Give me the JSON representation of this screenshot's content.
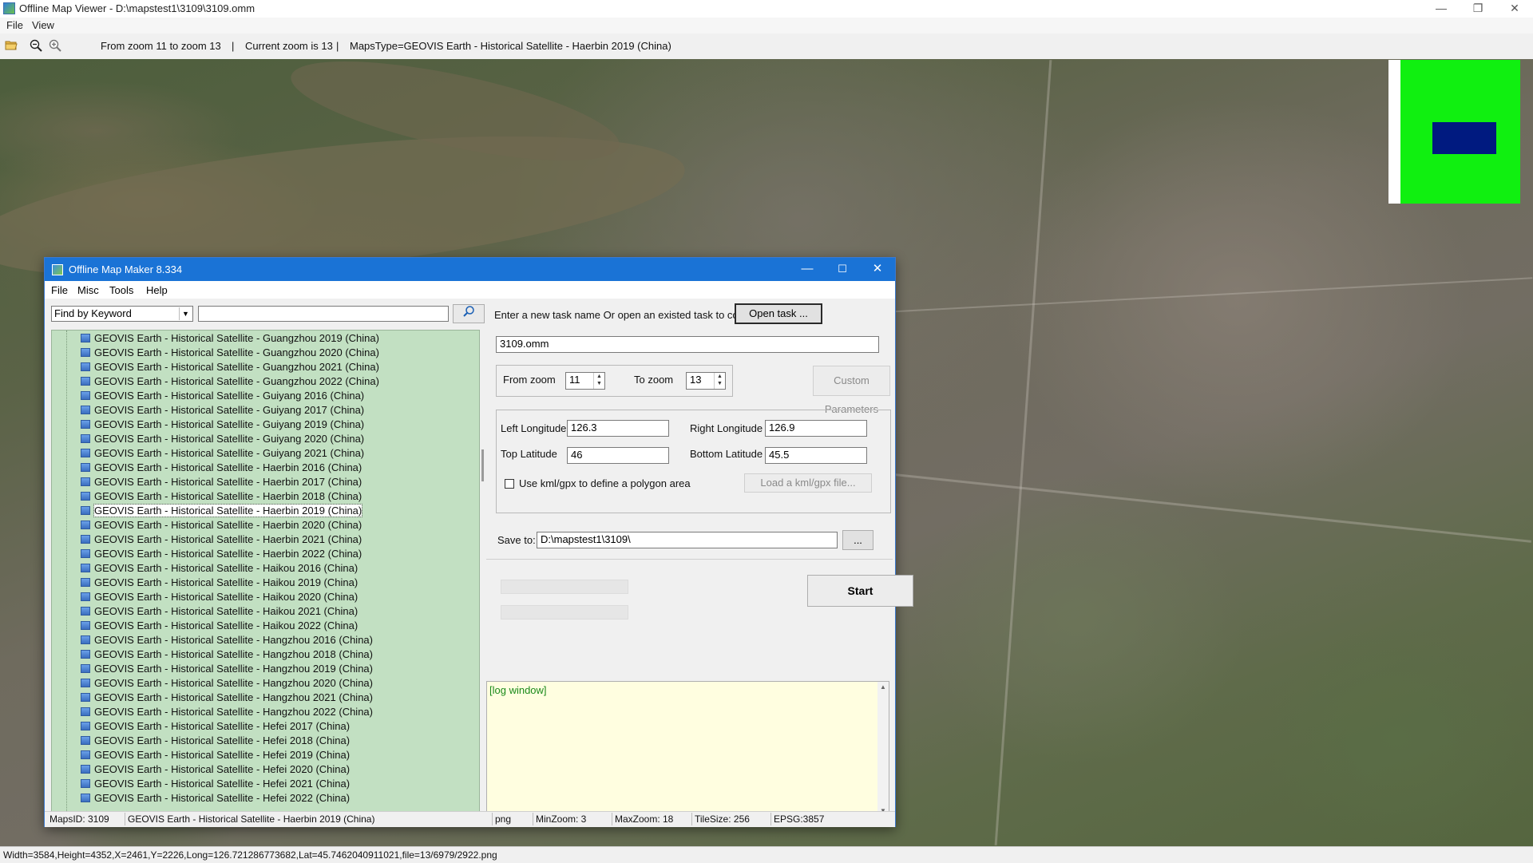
{
  "main_window": {
    "title": "Offline Map Viewer - D:\\mapstest1\\3109\\3109.omm",
    "minimize_glyph": "—",
    "maximize_glyph": "❐",
    "close_glyph": "✕"
  },
  "menu": {
    "file": "File",
    "view": "View"
  },
  "toolbar": {
    "open_icon": "folder-open-icon",
    "zoom_out_icon": "zoom-out-icon",
    "zoom_in_icon": "zoom-in-icon",
    "zoom_range": "From zoom 11 to zoom 13",
    "sep1": "|",
    "current_zoom": "Current zoom is 13",
    "sep2": "|",
    "maps_type": "MapsType=GEOVIS Earth - Historical Satellite - Haerbin 2019 (China)"
  },
  "status_bar": {
    "text": "Width=3584,Height=4352,X=2461,Y=2226,Long=126.721286773682,Lat=45.7462040911021,file=13/6979/2922.png"
  },
  "dialog": {
    "title": "Offline Map Maker 8.334",
    "menu": [
      "File",
      "Misc",
      "Tools",
      "Help"
    ],
    "search_mode": "Find by Keyword",
    "search_value": "",
    "tree_items": [
      "GEOVIS Earth - Historical Satellite - Guangzhou 2019 (China)",
      "GEOVIS Earth - Historical Satellite - Guangzhou 2020 (China)",
      "GEOVIS Earth - Historical Satellite - Guangzhou 2021 (China)",
      "GEOVIS Earth - Historical Satellite - Guangzhou 2022 (China)",
      "GEOVIS Earth - Historical Satellite - Guiyang 2016 (China)",
      "GEOVIS Earth - Historical Satellite - Guiyang 2017 (China)",
      "GEOVIS Earth - Historical Satellite - Guiyang 2019 (China)",
      "GEOVIS Earth - Historical Satellite - Guiyang 2020 (China)",
      "GEOVIS Earth - Historical Satellite - Guiyang 2021 (China)",
      "GEOVIS Earth - Historical Satellite - Haerbin 2016 (China)",
      "GEOVIS Earth - Historical Satellite - Haerbin 2017 (China)",
      "GEOVIS Earth - Historical Satellite - Haerbin 2018 (China)",
      "GEOVIS Earth - Historical Satellite - Haerbin 2019 (China)",
      "GEOVIS Earth - Historical Satellite - Haerbin 2020 (China)",
      "GEOVIS Earth - Historical Satellite - Haerbin 2021 (China)",
      "GEOVIS Earth - Historical Satellite - Haerbin 2022 (China)",
      "GEOVIS Earth - Historical Satellite - Haikou 2016 (China)",
      "GEOVIS Earth - Historical Satellite - Haikou 2019 (China)",
      "GEOVIS Earth - Historical Satellite - Haikou 2020 (China)",
      "GEOVIS Earth - Historical Satellite - Haikou 2021 (China)",
      "GEOVIS Earth - Historical Satellite - Haikou 2022 (China)",
      "GEOVIS Earth - Historical Satellite - Hangzhou 2016 (China)",
      "GEOVIS Earth - Historical Satellite - Hangzhou 2018 (China)",
      "GEOVIS Earth - Historical Satellite - Hangzhou 2019 (China)",
      "GEOVIS Earth - Historical Satellite - Hangzhou 2020 (China)",
      "GEOVIS Earth - Historical Satellite - Hangzhou 2021 (China)",
      "GEOVIS Earth - Historical Satellite - Hangzhou 2022 (China)",
      "GEOVIS Earth - Historical Satellite - Hefei 2017 (China)",
      "GEOVIS Earth - Historical Satellite - Hefei 2018 (China)",
      "GEOVIS Earth - Historical Satellite - Hefei 2019 (China)",
      "GEOVIS Earth - Historical Satellite - Hefei 2020 (China)",
      "GEOVIS Earth - Historical Satellite - Hefei 2021 (China)",
      "GEOVIS Earth - Historical Satellite - Hefei 2022 (China)"
    ],
    "selected_index": 12,
    "task_prompt": "Enter a new task name Or open an existed task to continue:",
    "open_task": "Open task ...",
    "task_name": "3109.omm",
    "from_zoom_label": "From zoom",
    "from_zoom": "11",
    "to_zoom_label": "To zoom",
    "to_zoom": "13",
    "custom_params": "Custom Parameters",
    "left_lon_label": "Left Longitude",
    "left_lon": "126.3",
    "right_lon_label": "Right Longitude",
    "right_lon": "126.9",
    "top_lat_label": "Top Latitude",
    "top_lat": "46",
    "bottom_lat_label": "Bottom Latitude",
    "bottom_lat": "45.5",
    "kml_label": "Use kml/gpx to define a polygon area",
    "load_kml": "Load a kml/gpx file...",
    "save_to_label": "Save to:",
    "save_to": "D:\\mapstest1\\3109\\",
    "browse": "...",
    "start": "Start",
    "log": "[log window]",
    "status": {
      "maps_id": "MapsID: 3109",
      "maps_name": "GEOVIS Earth - Historical Satellite - Haerbin 2019 (China)",
      "format": "png",
      "min_zoom": "MinZoom: 3",
      "max_zoom": "MaxZoom: 18",
      "tile_size": "TileSize: 256",
      "epsg": "EPSG:3857"
    }
  },
  "colors": {
    "dialog_title": "#1a73d6",
    "tree_bg": "#c2e0c2",
    "log_bg": "#fffee0",
    "overview_green": "#10f010",
    "overview_view": "#001a80"
  }
}
